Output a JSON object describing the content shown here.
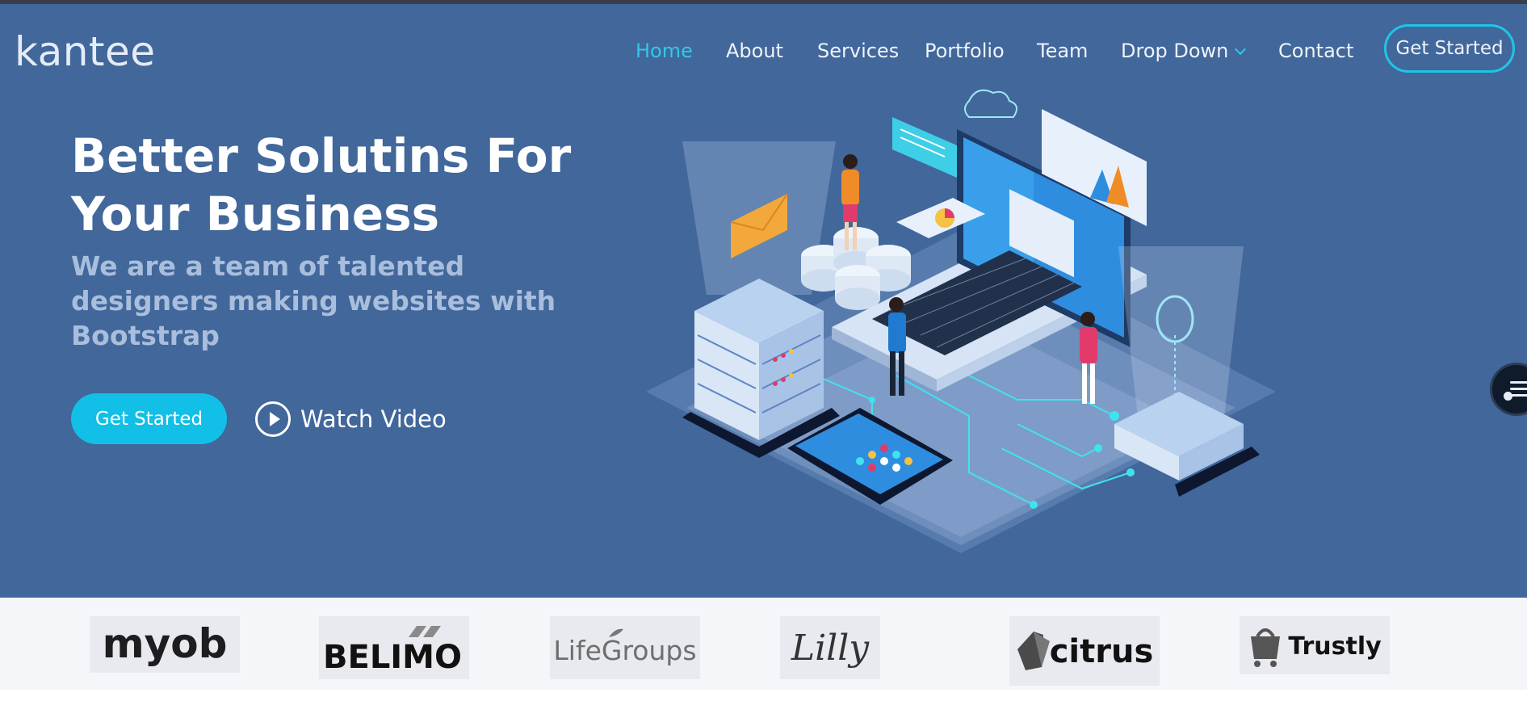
{
  "header": {
    "logo": "kantee",
    "nav": [
      {
        "label": "Home",
        "active": true
      },
      {
        "label": "About"
      },
      {
        "label": "Services"
      },
      {
        "label": "Portfolio"
      },
      {
        "label": "Team"
      },
      {
        "label": "Drop Down",
        "dropdown": true
      },
      {
        "label": "Contact"
      }
    ],
    "cta": "Get Started"
  },
  "hero": {
    "title": "Better Solutins For Your Business",
    "subtitle": "We are a team of talented designers making websites with Bootstrap",
    "primary_button": "Get Started",
    "video_button": "Watch Video",
    "illustration": "isometric-tech-illustration"
  },
  "clients": [
    {
      "name": "myob"
    },
    {
      "name": "BELIMO"
    },
    {
      "name": "LifeGroups"
    },
    {
      "name": "Lilly"
    },
    {
      "name": "citrus"
    },
    {
      "name": "Trustly"
    }
  ],
  "floating_widget": "settings-panel-icon",
  "colors": {
    "hero_bg": "#41679b",
    "accent": "#12bfe6",
    "nav_active": "#33c7ec",
    "subtitle": "#a9bedc",
    "clients_bg": "#f5f6fa"
  }
}
